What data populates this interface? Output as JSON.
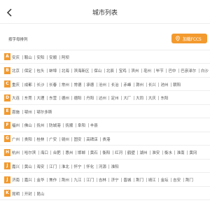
{
  "header": {
    "title": "城市列表"
  },
  "subheader": {
    "sort_label": "按字母排列",
    "location_button": "加载FCCS"
  },
  "colors": {
    "accent": "#f39a2f",
    "text": "#555555",
    "divider": "#eeeeee"
  },
  "icons": {
    "back": "chevron-left-icon",
    "location": "location-pin-icon"
  },
  "rows": [
    {
      "letter": "A",
      "cities": [
        "安庆",
        "鞍山",
        "安阳",
        "安顺",
        "阿坝"
      ]
    },
    {
      "letter": "B",
      "cities": [
        "北京",
        "保定",
        "包头",
        "蚌埠",
        "北海",
        "滨海新区",
        "保山",
        "北辰",
        "宝鸡",
        "滨州",
        "亳州",
        "毕节",
        "巴中",
        "巴彦淖尔",
        "白沙"
      ]
    },
    {
      "letter": "C",
      "cities": [
        "重庆",
        "成都",
        "长沙",
        "长春",
        "常州",
        "常德",
        "承德",
        "沧州",
        "长治",
        "赤峰",
        "滁州",
        "长兴",
        "池州",
        "朝阳"
      ]
    },
    {
      "letter": "D",
      "cities": [
        "大连",
        "东莞",
        "大理",
        "东营",
        "德州",
        "德阳",
        "丹阳",
        "达州",
        "定州",
        "大厂",
        "大同",
        "大庆",
        "东阳"
      ]
    },
    {
      "letter": "E",
      "cities": [
        "恩施",
        "鄂州",
        "鄂尔多斯"
      ]
    },
    {
      "letter": "F",
      "cities": [
        "福州",
        "佛山",
        "抚州",
        "防城港",
        "抚顺",
        "阜阳",
        "丰县"
      ]
    },
    {
      "letter": "G",
      "cities": [
        "广州",
        "贵阳",
        "桂林",
        "广安",
        "赣州",
        "固安",
        "高碑店",
        "贵港"
      ]
    },
    {
      "letter": "H",
      "cities": [
        "杭州",
        "哈尔滨",
        "海口",
        "合肥",
        "惠州",
        "邯郸",
        "黄石",
        "衡阳",
        "红河",
        "鹤壁",
        "湖州",
        "淮安",
        "衡水",
        "淮南",
        "黄冈"
      ]
    },
    {
      "letter": "J",
      "cities": [
        "嘉兴",
        "黄山",
        "海安",
        "江门",
        "淮北",
        "怀宁",
        "怀化",
        "河源",
        "淮阳"
      ]
    },
    {
      "letter": "J",
      "cities": [
        "济南",
        "嘉兴",
        "金华",
        "焦作",
        "荆州",
        "九江",
        "江门",
        "吉林",
        "济宁",
        "晋城",
        "荆门",
        "靖江",
        "金坛",
        "吉安",
        "荆门"
      ]
    },
    {
      "letter": "K",
      "cities": [
        "昆明",
        "开封",
        "昆山"
      ]
    }
  ]
}
